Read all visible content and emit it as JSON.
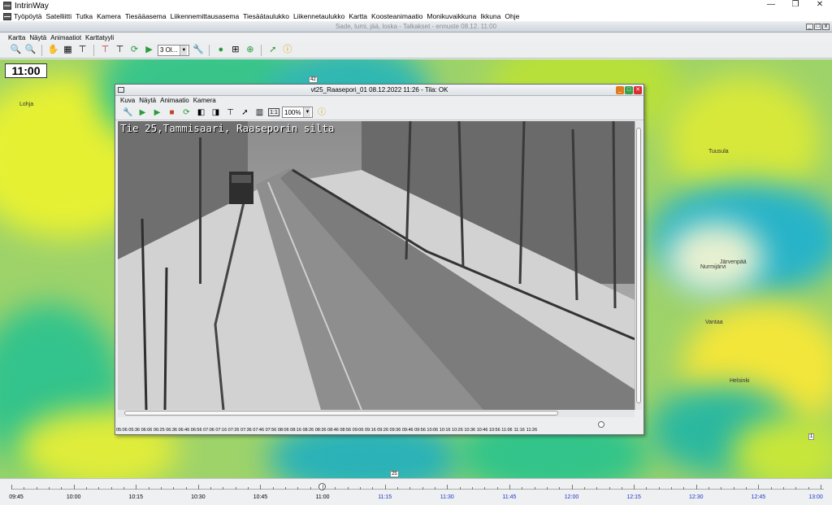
{
  "app": {
    "title": "IntrinWay"
  },
  "main_menu": [
    "Työpöytä",
    "Satelliitti",
    "Tutka",
    "Kamera",
    "Tiesääasema",
    "Liikennemittausasema",
    "Tiesäätaulukko",
    "Liikennetaulukko",
    "Kartta",
    "Koosteanimaatio",
    "Monikuvaikkuna",
    "Ikkuna",
    "Ohje"
  ],
  "inner_window": {
    "title": "Sade, lumi, jää, loska - Talkakset - ennuste 08.12. 11:00"
  },
  "map_menu": [
    "Kartta",
    "Näytä",
    "Animaatiot",
    "Karttatyyli"
  ],
  "map_toolbar": {
    "combo_value": "3 Ol..."
  },
  "map": {
    "time": "11:00",
    "places": {
      "a": "Nurmijärvi",
      "b": "Järvenpää",
      "c": "Vantaa",
      "d": "Helsinki",
      "e": "Lohja",
      "f": "Tuusula"
    },
    "roads": {
      "r1": "42",
      "r2": "25",
      "r3": "1"
    }
  },
  "camera_window": {
    "title": "vt25_Raasepori_01 08.12.2022  11:26 - Tila: OK",
    "menu": [
      "Kuva",
      "Näytä",
      "Animaatio",
      "Kamera"
    ],
    "zoom_value": "100%",
    "image_caption": "Tie 25,Tammisaari, Raaseporin silta",
    "timeline_labels": [
      "05:06",
      "05:36",
      "06:06",
      "06:25",
      "06:36",
      "06:46",
      "06:56",
      "07:06",
      "07:16",
      "07:26",
      "07:36",
      "07:46",
      "07:56",
      "08:06",
      "08:16",
      "08:26",
      "08:36",
      "08:46",
      "08:56",
      "09:06",
      "09:16",
      "09:26",
      "09:36",
      "09:46",
      "09:56",
      "10:06",
      "10:16",
      "10:26",
      "10:36",
      "10:46",
      "10:56",
      "11:06",
      "11:16",
      "11:26"
    ]
  },
  "timeline": {
    "labels": [
      "09:45",
      "10:00",
      "10:15",
      "10:30",
      "10:45",
      "11:00",
      "11:15",
      "11:30",
      "11:45",
      "12:00",
      "12:15",
      "12:30",
      "12:45",
      "13:00"
    ],
    "future_from_index": 6
  }
}
